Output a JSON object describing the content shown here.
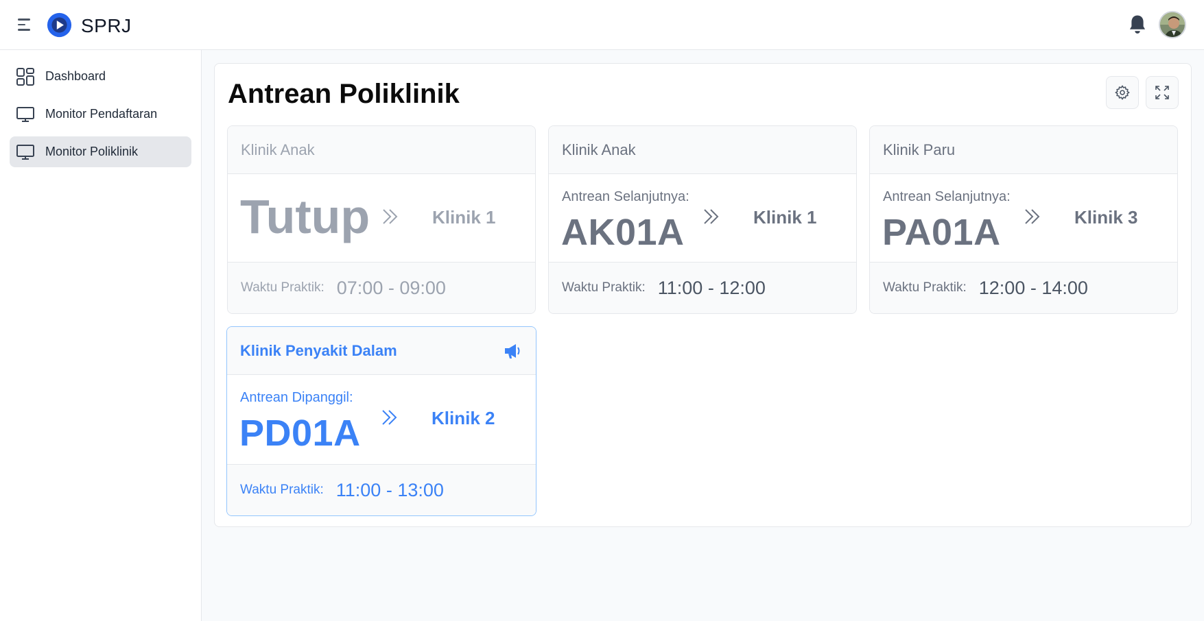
{
  "app": {
    "brand": "SPRJ",
    "colors": {
      "accent": "#3b82f6",
      "muted": "#6b7280",
      "closed": "#9ca3af"
    }
  },
  "header": {
    "menu_icon": "hamburger-icon",
    "logo_icon": "play-logo-icon",
    "notification_icon": "bell-icon",
    "avatar_icon": "user-avatar"
  },
  "sidebar": {
    "items": [
      {
        "label": "Dashboard",
        "icon": "grid-icon",
        "active": false
      },
      {
        "label": "Monitor Pendaftaran",
        "icon": "monitor-icon",
        "active": false
      },
      {
        "label": "Monitor Poliklinik",
        "icon": "monitor-icon",
        "active": true
      }
    ]
  },
  "main": {
    "title": "Antrean Poliklinik",
    "settings_icon": "gear-icon",
    "fullscreen_icon": "expand-icon",
    "cards": [
      {
        "clinic": "Klinik Anak",
        "state": "closed",
        "status_text": "Tutup",
        "room": "Klinik 1",
        "time_label": "Waktu Praktik:",
        "time": "07:00 - 09:00"
      },
      {
        "clinic": "Klinik Anak",
        "state": "next",
        "queue_label": "Antrean Selanjutnya:",
        "queue_code": "AK01A",
        "room": "Klinik 1",
        "time_label": "Waktu Praktik:",
        "time": "11:00 - 12:00"
      },
      {
        "clinic": "Klinik Paru",
        "state": "next",
        "queue_label": "Antrean Selanjutnya:",
        "queue_code": "PA01A",
        "room": "Klinik 3",
        "time_label": "Waktu Praktik:",
        "time": "12:00 - 14:00"
      },
      {
        "clinic": "Klinik Penyakit Dalam",
        "state": "called",
        "queue_label": "Antrean Dipanggil:",
        "queue_code": "PD01A",
        "room": "Klinik 2",
        "time_label": "Waktu Praktik:",
        "time": "11:00 - 13:00",
        "announce_icon": "megaphone-icon"
      }
    ]
  }
}
